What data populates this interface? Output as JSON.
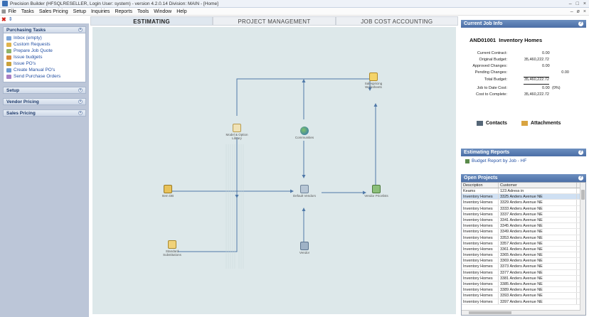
{
  "window": {
    "title": "Precision Builder (HFSQLRESELLER, Login User: system) - version 4.2.0.14 Division: MAIN - [Home]"
  },
  "menu": [
    "File",
    "Tasks",
    "Sales Pricing",
    "Setup",
    "Inquiries",
    "Reports",
    "Tools",
    "Window",
    "Help"
  ],
  "left": {
    "purchasing_title": "Purchasing Tasks",
    "tasks": [
      "Inbox (empty)",
      "Custom Requests",
      "Prepare Job Quote",
      "Issue budgets",
      "Issue PO's",
      "Create Manual PO's",
      "Send Purchase Orders"
    ],
    "setup": "Setup",
    "vendor_pricing": "Vendor Pricing",
    "sales_pricing": "Sales Pricing"
  },
  "tabs": [
    "ESTIMATING",
    "PROJECT MANAGEMENT",
    "JOB COST ACCOUNTING"
  ],
  "nodes": {
    "worksheets": "Salespricing Worksheets",
    "model": "Model & Option Library",
    "communities": "Communities",
    "itemdb": "Item DB",
    "default_vendors": "Default Vendors",
    "vendor_pricelists": "Vendor Pricelists",
    "std_subs": "Standard Substitutions",
    "vendor": "Vendor"
  },
  "job": {
    "panel_title": "Current Job Info",
    "id": "AND01001",
    "name": "Inventory Homes",
    "rows": [
      {
        "label": "Current Contract:",
        "value": "0.00"
      },
      {
        "label": "Original Budget:",
        "value": "35,460,222.72"
      },
      {
        "label": "Approved Changes:",
        "value": "0.00"
      },
      {
        "label": "Pending Changes:",
        "value": "0.00"
      },
      {
        "label": "Total Budget:",
        "value": "35,460,222.72"
      },
      {
        "label": "Job to Date Cost:",
        "value": "0.00"
      },
      {
        "label": "Cost to Complete:",
        "value": "35,460,222.72"
      }
    ],
    "jtd_pct": "(0%)",
    "contacts": "Contacts",
    "attachments": "Attachments"
  },
  "est_reports": {
    "title": "Estimating Reports",
    "link": "Budget Report by Job - HF"
  },
  "open_projects": {
    "title": "Open Projects",
    "columns": [
      "Description",
      "Customer"
    ],
    "rows": [
      [
        "Keams",
        "123 Adress in"
      ],
      [
        "Inventory Homes",
        "3325 Anders Avenue NE"
      ],
      [
        "Inventory Homes",
        "3329 Anders Avenue NE"
      ],
      [
        "Inventory Homes",
        "3333 Anders Avenue NE"
      ],
      [
        "Inventory Homes",
        "3337 Anders Avenue NE"
      ],
      [
        "Inventory Homes",
        "3341 Anders Avenue NE"
      ],
      [
        "Inventory Homes",
        "3345 Anders Avenue NE"
      ],
      [
        "Inventory Homes",
        "3349 Anders Avenue NE"
      ],
      [
        "Inventory Homes",
        "3353 Anders Avenue NE"
      ],
      [
        "Inventory Homes",
        "3357 Anders Avenue NE"
      ],
      [
        "Inventory Homes",
        "3361 Anders Avenue NE"
      ],
      [
        "Inventory Homes",
        "3365 Anders Avenue NE"
      ],
      [
        "Inventory Homes",
        "3369 Anders Avenue NE"
      ],
      [
        "Inventory Homes",
        "3373 Anders Avenue NE"
      ],
      [
        "Inventory Homes",
        "3377 Anders Avenue NE"
      ],
      [
        "Inventory Homes",
        "3381 Anders Avenue NE"
      ],
      [
        "Inventory Homes",
        "3385 Anders Avenue NE"
      ],
      [
        "Inventory Homes",
        "3389 Anders Avenue NE"
      ],
      [
        "Inventory Homes",
        "3393 Anders Avenue NE"
      ],
      [
        "Inventory Homes",
        "3397 Anders Avenue NE"
      ]
    ]
  }
}
